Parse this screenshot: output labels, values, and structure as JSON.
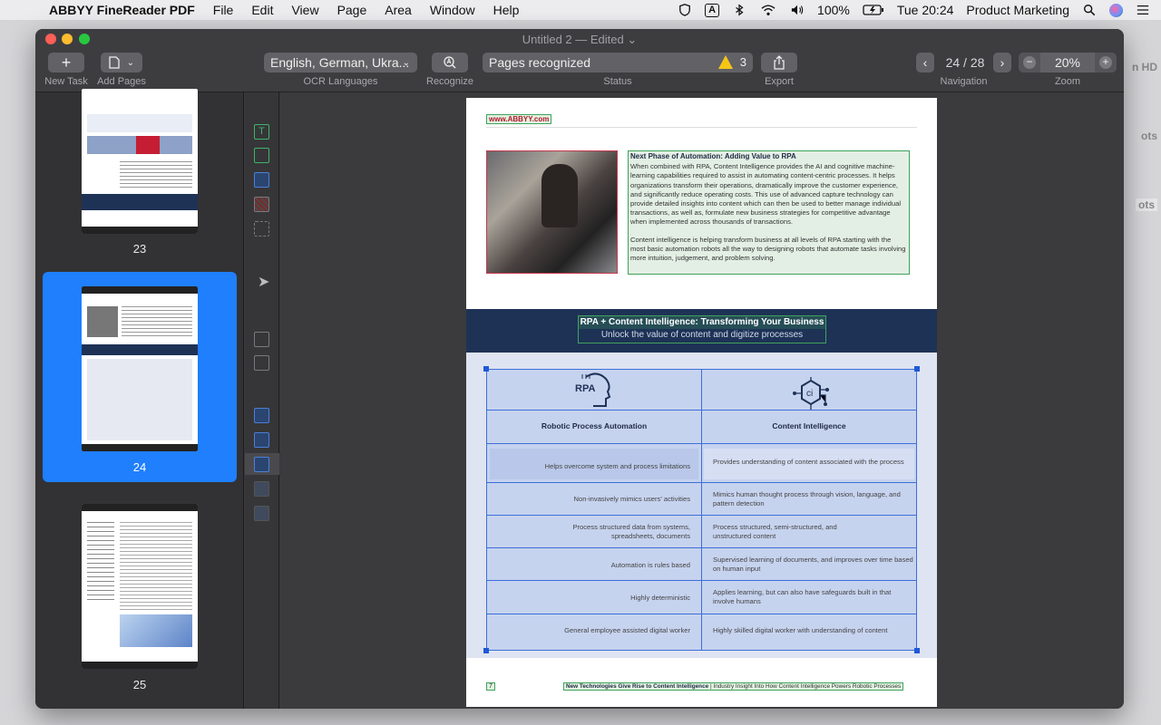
{
  "menubar": {
    "app_name": "ABBYY FineReader PDF",
    "items": [
      "File",
      "Edit",
      "View",
      "Page",
      "Area",
      "Window",
      "Help"
    ],
    "battery": "100%",
    "clock": "Tue 20:24",
    "user": "Product Marketing",
    "input_source": "A"
  },
  "desktop": {
    "labels": [
      "n HD",
      "ots",
      "ots"
    ]
  },
  "window": {
    "title": "Untitled 2 — Edited ⌄"
  },
  "toolbar": {
    "new_task_label": "New Task",
    "add_pages_label": "Add Pages",
    "ocr_languages_label": "OCR Languages",
    "ocr_languages_value": "English, German, Ukra...",
    "recognize_label": "Recognize",
    "status_label": "Status",
    "status_value": "Pages recognized",
    "warning_count": "3",
    "export_label": "Export",
    "navigation_label": "Navigation",
    "page_indicator": "24 / 28",
    "zoom_label": "Zoom",
    "zoom_value": "20%"
  },
  "sidebar": {
    "pages": [
      {
        "number": "23",
        "selected": false
      },
      {
        "number": "24",
        "selected": true
      },
      {
        "number": "25",
        "selected": false
      }
    ]
  },
  "document": {
    "header_link": "www.ABBYY.com",
    "section_title": "Next Phase of Automation: Adding Value to RPA",
    "paragraph_1": "When combined with RPA, Content Intelligence provides the AI and cognitive machine-learning capabilities required to assist in automating content-centric processes. It helps organizations transform their operations, dramatically improve the customer experience, and significantly reduce operating costs. This use of advanced capture technology can provide detailed insights into content which can then be used to better manage individual transactions, as well as, formulate new business strategies for competitive advantage when implemented across thousands of transactions.",
    "paragraph_2": "Content intelligence is helping transform business at all levels of RPA starting with the most basic automation robots all the way to designing robots that automate tasks involving more intuition, judgement, and problem solving.",
    "band_title": "RPA + Content Intelligence: Transforming Your Business",
    "band_subtitle": "Unlock the value of content and digitize processes",
    "table": {
      "icon_left_text": "RPA",
      "icon_right_text": "ci",
      "col_left": "Robotic Process Automation",
      "col_right": "Content Intelligence",
      "rows": [
        {
          "left": "Helps overcome system and process limitations",
          "right": "Provides understanding of content associated with the process"
        },
        {
          "left": "Non-invasively mimics users' activities",
          "right": "Mimics human thought process through vision, language, and pattern detection"
        },
        {
          "left": "Process structured data from systems, spreadsheets, documents",
          "right": "Process structured, semi-structured, and unstructured content"
        },
        {
          "left": "Automation is rules based",
          "right": "Supervised learning of documents, and improves over time based on human input"
        },
        {
          "left": "Highly deterministic",
          "right": "Applies learning, but can also have safeguards built in that involve humans"
        },
        {
          "left": "General employee assisted digital worker",
          "right": "Highly skilled digital worker with understanding of content"
        }
      ]
    },
    "footer_page_number": "7",
    "footer_bold": "New Technologies Give Rise to Content Intelligence",
    "footer_rest": " | Industry Insight Into How Content Intelligence Powers Robotic Processes"
  }
}
